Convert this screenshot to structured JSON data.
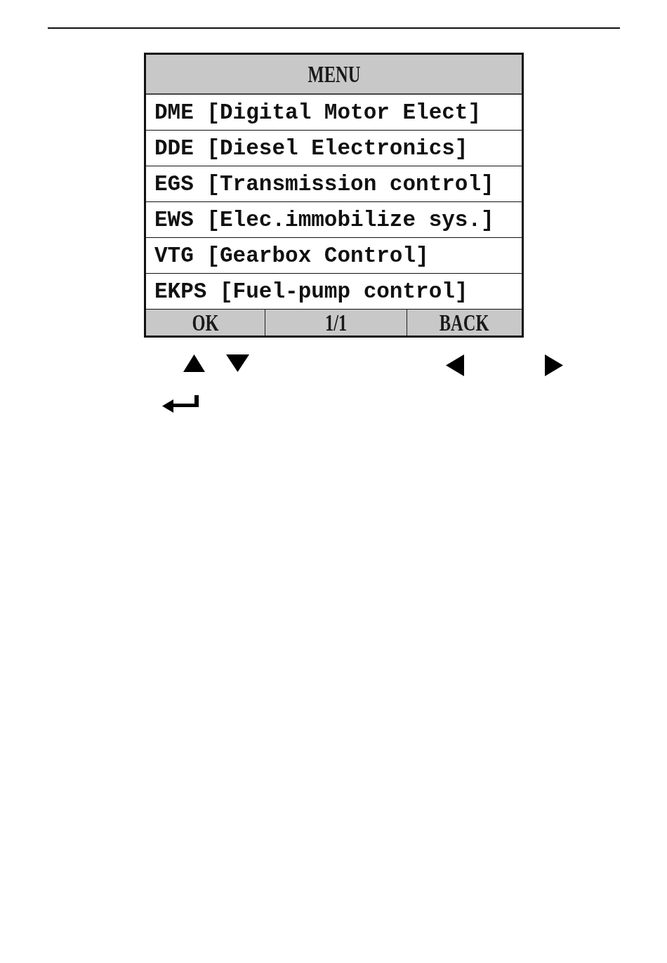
{
  "screen": {
    "title": "MENU",
    "items": [
      "DME [Digital Motor Elect]",
      "DDE [Diesel Electronics]",
      "EGS [Transmission control]",
      "EWS [Elec.immobilize sys.]",
      "VTG [Gearbox Control]",
      "EKPS [Fuel-pump control]"
    ],
    "footer": {
      "left_key": "OK",
      "page": "1/1",
      "right_key": "BACK"
    }
  }
}
